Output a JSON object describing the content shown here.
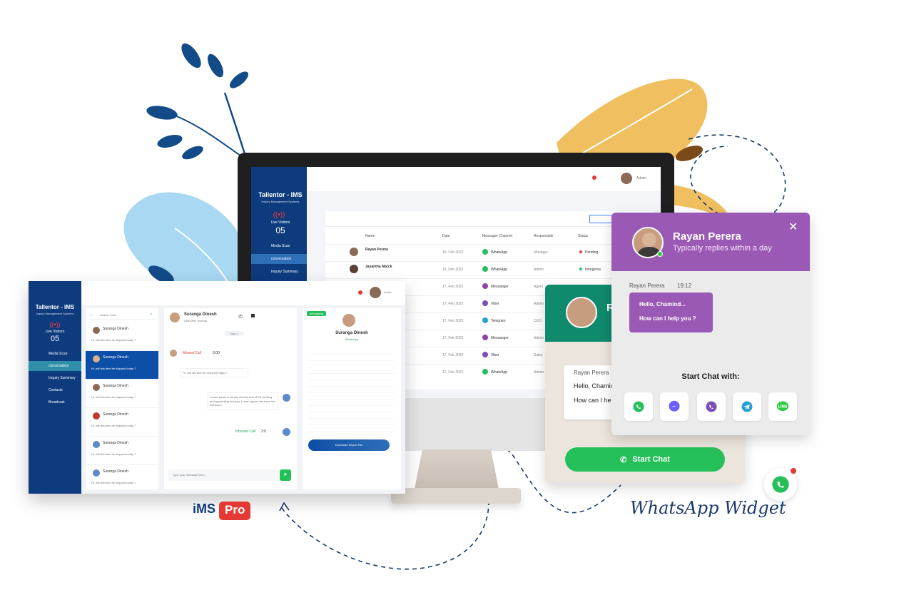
{
  "brand": {
    "ims_logo_main": "iMS",
    "ims_logo_badge": "Pro"
  },
  "monitor": {
    "app_title": "Tallentor - IMS",
    "app_subtitle": "Inquiry Management Systems",
    "live_visitors_label": "Live Visitors",
    "live_visitors_count": "05",
    "nav": [
      "Media Scan",
      "conversation",
      "Inquiry Summary"
    ],
    "user": "Admin",
    "columns": [
      "Name",
      "Date",
      "Messager Channel",
      "Responsible",
      "Status"
    ],
    "rows": [
      {
        "name": "Rayan Perera",
        "date": "15, Feb 2022",
        "channel": "WhatsApp",
        "responsible": "Manager",
        "status": "Pending"
      },
      {
        "name": "Jayantha Marck",
        "date": "15, Feb 2022",
        "channel": "WhatsApp",
        "responsible": "Admin",
        "status": "Inhogress"
      },
      {
        "name": "",
        "date": "17, Feb 2022",
        "channel": "Messanger",
        "responsible": "Agent",
        "status": ""
      },
      {
        "name": "",
        "date": "17, Feb 2022",
        "channel": "Viber",
        "responsible": "Admin",
        "status": ""
      },
      {
        "name": "",
        "date": "17, Feb 2022",
        "channel": "Telegram",
        "responsible": "CEO",
        "status": ""
      },
      {
        "name": "",
        "date": "17, Feb 2022",
        "channel": "Messanger",
        "responsible": "Admin",
        "status": ""
      },
      {
        "name": "",
        "date": "17, Feb 2022",
        "channel": "Viber",
        "responsible": "Sales",
        "status": ""
      },
      {
        "name": "",
        "date": "17, Feb 2022",
        "channel": "WhatsApp",
        "responsible": "Admin",
        "status": ""
      }
    ]
  },
  "front": {
    "app_title": "Tallentor - IMS",
    "app_subtitle": "Inquiry Management Systems",
    "live_visitors_label": "Live Visitors",
    "live_visitors_count": "05",
    "nav": [
      "Media Scan",
      "conversation",
      "Inquiry Summary",
      "Contacts",
      "Broadcast"
    ],
    "user": "Admin",
    "search_placeholder": "Search Chat",
    "contacts": [
      {
        "name": "Suranga Dinesh",
        "preview": "Hi, will this item be shipped today ?",
        "time": "5m"
      },
      {
        "name": "Suranga Dinesh",
        "preview": "Hi, will this item be shipped today ?",
        "time": "5m"
      },
      {
        "name": "Suranga Dinesh",
        "preview": "Hi, will this item be shipped today ?",
        "time": "5m"
      },
      {
        "name": "Suranga Dinesh",
        "preview": "Hi, will this item be shipped today ?",
        "time": "5m"
      },
      {
        "name": "Suranga Dinesh",
        "preview": "Hi, will this item be shipped today ?",
        "time": "5m"
      },
      {
        "name": "Suranga Dinesh",
        "preview": "Hi, will this item be shipped today ?",
        "time": "5m"
      }
    ],
    "chat_name": "Suranga Dinesh",
    "chat_sub": "Last seen recently",
    "date_chip": "Sept 2",
    "missed_call": "Missed Call",
    "missed_time": "3:00",
    "msg_in": "Hi, will this item be shipped today ?",
    "msg_out": "Lorem Ipsum is simply dummy text of the printing and typesetting industry. Lorem Ipsum has been the industry's",
    "inbound_call": "Inbound Call",
    "inbound_time": "2:0",
    "input_placeholder": "Type your message here...",
    "profile_tag": "InProgress",
    "profile_name": "Suranga Dinesh",
    "profile_channel": "WhatsApp",
    "download_btn": "Download Report File"
  },
  "rayan_widget": {
    "name": "Rayan Perera",
    "status": "Typically replies within a day",
    "sender": "Rayan Perera",
    "time": "19:12",
    "line1": "Hello, Chamind...",
    "line2": "How can I help you ?",
    "start_with": "Start Chat with:",
    "channels": [
      "whatsapp-icon",
      "messenger-icon",
      "viber-icon",
      "telegram-icon",
      "line-icon"
    ]
  },
  "whatsapp_widget": {
    "initial": "R",
    "sender": "Rayan Perera",
    "line1": "Hello, Chamin",
    "line2": "How can I hel",
    "button": "Start Chat",
    "label": "WhatsApp Widget"
  },
  "colors": {
    "navy": "#0d3b7e",
    "purple": "#9b59b6",
    "green": "#25c05a",
    "teal": "#0f8a6c",
    "red": "#e53935"
  }
}
